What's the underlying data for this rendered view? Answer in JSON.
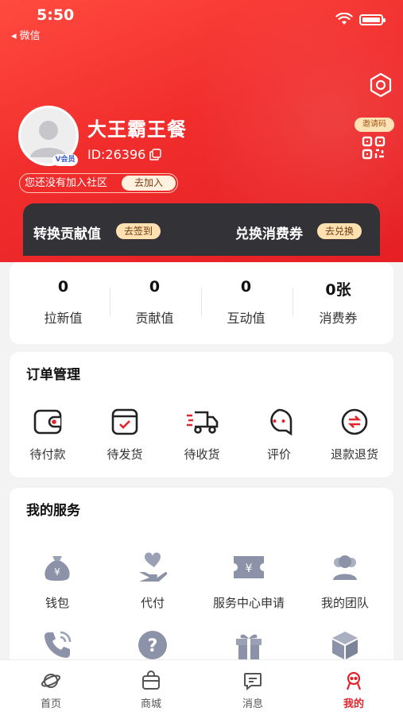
{
  "status_bar": {
    "time": "5:50",
    "back_app": "◂ 微信"
  },
  "header": {
    "invite_badge": "邀请码",
    "nickname": "大王霸王餐",
    "user_id": "ID:26396",
    "vip_badge": "V会员",
    "community_text": "您还没有加入社区",
    "join_button": "去加入"
  },
  "promo_bar": {
    "left_label": "转换贡献值",
    "left_button": "去签到",
    "right_label": "兑换消费券",
    "right_button": "去兑换"
  },
  "stats": [
    {
      "value": "0",
      "label": "拉新值"
    },
    {
      "value": "0",
      "label": "贡献值"
    },
    {
      "value": "0",
      "label": "互动值"
    },
    {
      "value": "0张",
      "label": "消费券"
    }
  ],
  "orders": {
    "title": "订单管理",
    "items": [
      {
        "label": "待付款",
        "icon": "wallet-icon"
      },
      {
        "label": "待发货",
        "icon": "box-check-icon"
      },
      {
        "label": "待收货",
        "icon": "truck-icon"
      },
      {
        "label": "评价",
        "icon": "chat-bubble-icon"
      },
      {
        "label": "退款退货",
        "icon": "refund-icon"
      }
    ]
  },
  "services": {
    "title": "我的服务",
    "items": [
      {
        "label": "钱包",
        "icon": "money-bag-icon"
      },
      {
        "label": "代付",
        "icon": "heart-hand-icon"
      },
      {
        "label": "服务中心申请",
        "icon": "ticket-icon"
      },
      {
        "label": "我的团队",
        "icon": "team-icon"
      },
      {
        "label": "",
        "icon": "phone-icon"
      },
      {
        "label": "",
        "icon": "help-icon"
      },
      {
        "label": "",
        "icon": "gift-icon"
      },
      {
        "label": "",
        "icon": "cube-icon"
      }
    ]
  },
  "tabbar": [
    {
      "label": "首页",
      "icon": "planet-icon",
      "active": false
    },
    {
      "label": "商城",
      "icon": "shop-bag-icon",
      "active": false
    },
    {
      "label": "消息",
      "icon": "message-icon",
      "active": false
    },
    {
      "label": "我的",
      "icon": "profile-icon",
      "active": true
    }
  ],
  "colors": {
    "brand_red": "#e4232b",
    "dark_bar": "#333337",
    "gold": "#ffe0b0",
    "icon_gray": "#8c93a8"
  }
}
